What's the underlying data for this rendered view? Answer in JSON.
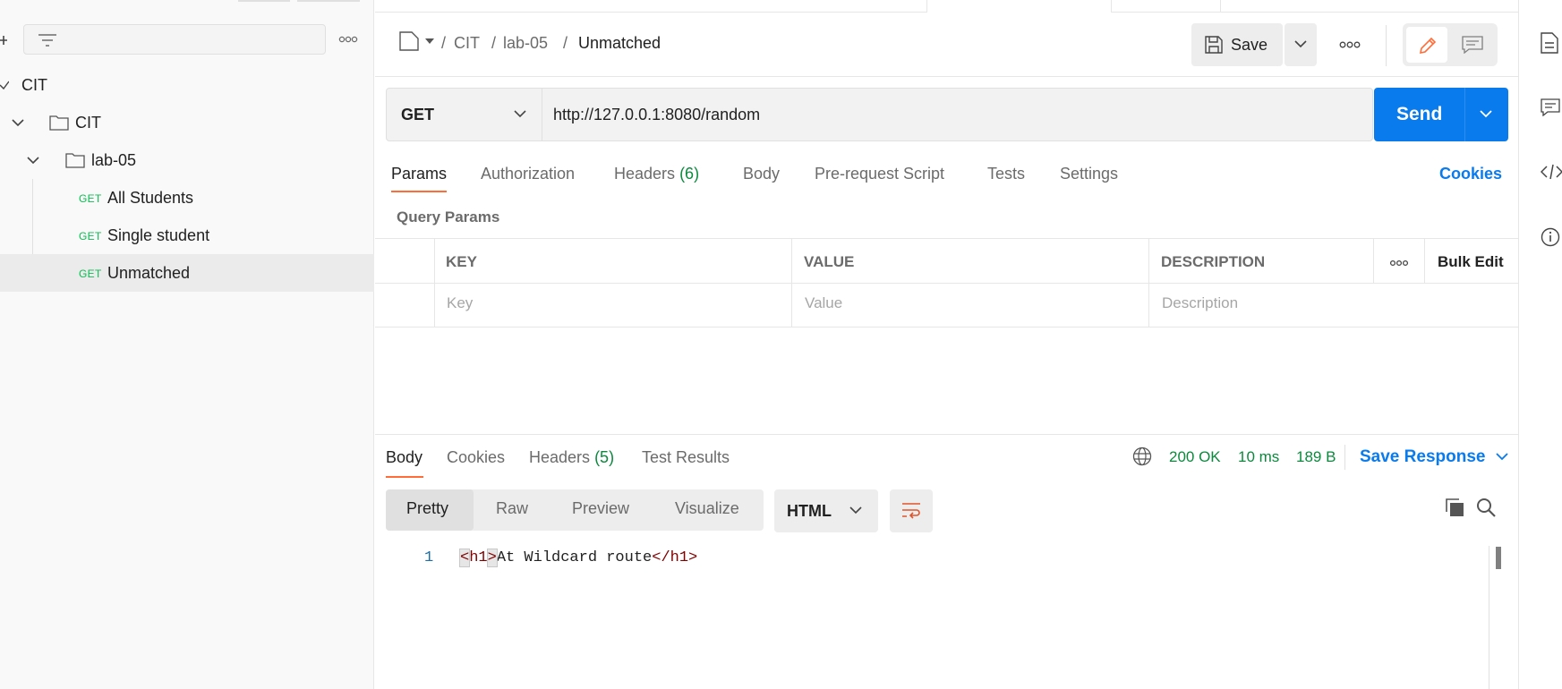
{
  "sidebar": {
    "filter_placeholder": "",
    "tree": [
      {
        "label": "CIT",
        "type": "collection"
      },
      {
        "label": "CIT",
        "type": "folder"
      },
      {
        "label": "lab-05",
        "type": "folder"
      },
      {
        "method": "GET",
        "label": "All Students",
        "type": "request"
      },
      {
        "method": "GET",
        "label": "Single student",
        "type": "request"
      },
      {
        "method": "GET",
        "label": "Unmatched",
        "type": "request",
        "selected": true
      }
    ]
  },
  "header": {
    "breadcrumb": [
      "CIT",
      "lab-05",
      "Unmatched"
    ],
    "separator": "/",
    "save_label": "Save"
  },
  "request": {
    "method": "GET",
    "url": "http://127.0.0.1:8080/random",
    "send_label": "Send",
    "tabs": {
      "params": "Params",
      "authorization": "Authorization",
      "headers": "Headers",
      "headers_count": "(6)",
      "body": "Body",
      "prerequest": "Pre-request Script",
      "tests": "Tests",
      "settings": "Settings"
    },
    "cookies_label": "Cookies",
    "query_params_title": "Query Params",
    "table": {
      "headers": {
        "key": "KEY",
        "value": "VALUE",
        "description": "DESCRIPTION",
        "bulk_edit": "Bulk Edit"
      },
      "placeholders": {
        "key": "Key",
        "value": "Value",
        "description": "Description"
      }
    }
  },
  "response": {
    "tabs": {
      "body": "Body",
      "cookies": "Cookies",
      "headers": "Headers",
      "headers_count": "(5)",
      "test_results": "Test Results"
    },
    "status": "200 OK",
    "time": "10 ms",
    "size": "189 B",
    "save_response_label": "Save Response",
    "views": {
      "pretty": "Pretty",
      "raw": "Raw",
      "preview": "Preview",
      "visualize": "Visualize"
    },
    "format": "HTML",
    "code": {
      "line_number": "1",
      "open_lt": "<",
      "open_tag": "h1",
      "open_gt": ">",
      "text": "At Wildcard route",
      "close_tag": "</h1>"
    }
  },
  "colors": {
    "accent_orange": "#ff6c37",
    "send_blue": "#097bed",
    "status_green": "#0b8a3e",
    "method_green": "#0cbb52"
  },
  "icons": [
    "plus-icon",
    "filter-icon",
    "more-icon",
    "chevron-down-icon",
    "folder-icon",
    "document-icon",
    "save-icon",
    "edit-icon",
    "comment-icon",
    "globe-icon",
    "wrap-icon",
    "copy-icon",
    "search-icon",
    "code-icon",
    "info-icon"
  ]
}
